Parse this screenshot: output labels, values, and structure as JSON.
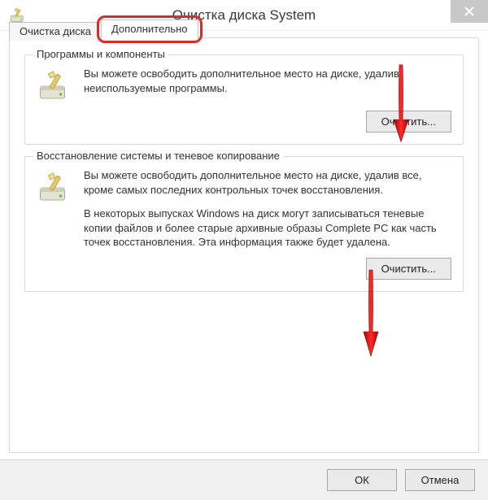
{
  "window": {
    "title": "Очистка диска System"
  },
  "tabs": {
    "disk_cleanup": "Очистка диска",
    "advanced": "Дополнительно"
  },
  "group_programs": {
    "legend": "Программы и компоненты",
    "text": "Вы можете освободить дополнительное место на диске, удалив неиспользуемые программы.",
    "cleanup_btn": "Очистить..."
  },
  "group_restore": {
    "legend": "Восстановление системы и теневое копирование",
    "text1": "Вы можете освободить дополнительное место на диске, удалив все, кроме самых последних контрольных точек восстановления.",
    "text2": "В некоторых выпусках Windows на диск могут записываться теневые копии файлов и более старые архивные образы Complete PC как часть точек восстановления. Эта информация также будет удалена.",
    "cleanup_btn": "Очистить..."
  },
  "footer": {
    "ok": "ОК",
    "cancel": "Отмена"
  },
  "colors": {
    "highlight": "#d62d2d",
    "arrow": "#d40f0f"
  }
}
